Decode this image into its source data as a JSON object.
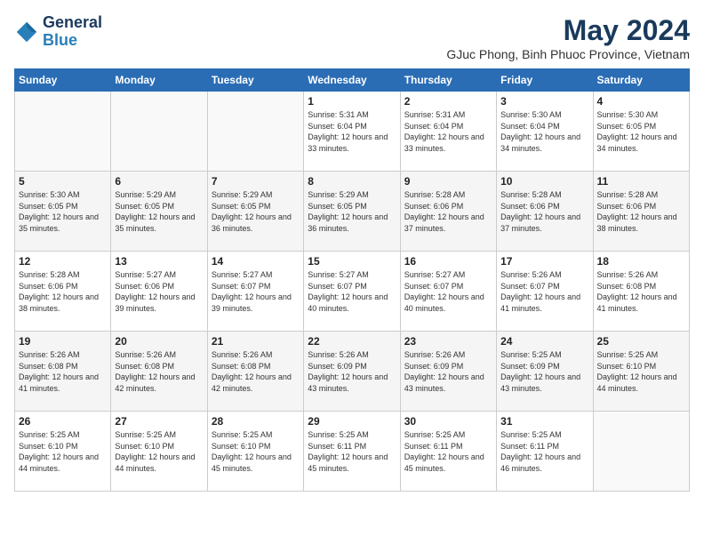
{
  "header": {
    "logo_line1": "General",
    "logo_line2": "Blue",
    "title": "May 2024",
    "subtitle": "GJuc Phong, Binh Phuoc Province, Vietnam"
  },
  "weekdays": [
    "Sunday",
    "Monday",
    "Tuesday",
    "Wednesday",
    "Thursday",
    "Friday",
    "Saturday"
  ],
  "weeks": [
    [
      {
        "day": "",
        "sunrise": "",
        "sunset": "",
        "daylight": ""
      },
      {
        "day": "",
        "sunrise": "",
        "sunset": "",
        "daylight": ""
      },
      {
        "day": "",
        "sunrise": "",
        "sunset": "",
        "daylight": ""
      },
      {
        "day": "1",
        "sunrise": "Sunrise: 5:31 AM",
        "sunset": "Sunset: 6:04 PM",
        "daylight": "Daylight: 12 hours and 33 minutes."
      },
      {
        "day": "2",
        "sunrise": "Sunrise: 5:31 AM",
        "sunset": "Sunset: 6:04 PM",
        "daylight": "Daylight: 12 hours and 33 minutes."
      },
      {
        "day": "3",
        "sunrise": "Sunrise: 5:30 AM",
        "sunset": "Sunset: 6:04 PM",
        "daylight": "Daylight: 12 hours and 34 minutes."
      },
      {
        "day": "4",
        "sunrise": "Sunrise: 5:30 AM",
        "sunset": "Sunset: 6:05 PM",
        "daylight": "Daylight: 12 hours and 34 minutes."
      }
    ],
    [
      {
        "day": "5",
        "sunrise": "Sunrise: 5:30 AM",
        "sunset": "Sunset: 6:05 PM",
        "daylight": "Daylight: 12 hours and 35 minutes."
      },
      {
        "day": "6",
        "sunrise": "Sunrise: 5:29 AM",
        "sunset": "Sunset: 6:05 PM",
        "daylight": "Daylight: 12 hours and 35 minutes."
      },
      {
        "day": "7",
        "sunrise": "Sunrise: 5:29 AM",
        "sunset": "Sunset: 6:05 PM",
        "daylight": "Daylight: 12 hours and 36 minutes."
      },
      {
        "day": "8",
        "sunrise": "Sunrise: 5:29 AM",
        "sunset": "Sunset: 6:05 PM",
        "daylight": "Daylight: 12 hours and 36 minutes."
      },
      {
        "day": "9",
        "sunrise": "Sunrise: 5:28 AM",
        "sunset": "Sunset: 6:06 PM",
        "daylight": "Daylight: 12 hours and 37 minutes."
      },
      {
        "day": "10",
        "sunrise": "Sunrise: 5:28 AM",
        "sunset": "Sunset: 6:06 PM",
        "daylight": "Daylight: 12 hours and 37 minutes."
      },
      {
        "day": "11",
        "sunrise": "Sunrise: 5:28 AM",
        "sunset": "Sunset: 6:06 PM",
        "daylight": "Daylight: 12 hours and 38 minutes."
      }
    ],
    [
      {
        "day": "12",
        "sunrise": "Sunrise: 5:28 AM",
        "sunset": "Sunset: 6:06 PM",
        "daylight": "Daylight: 12 hours and 38 minutes."
      },
      {
        "day": "13",
        "sunrise": "Sunrise: 5:27 AM",
        "sunset": "Sunset: 6:06 PM",
        "daylight": "Daylight: 12 hours and 39 minutes."
      },
      {
        "day": "14",
        "sunrise": "Sunrise: 5:27 AM",
        "sunset": "Sunset: 6:07 PM",
        "daylight": "Daylight: 12 hours and 39 minutes."
      },
      {
        "day": "15",
        "sunrise": "Sunrise: 5:27 AM",
        "sunset": "Sunset: 6:07 PM",
        "daylight": "Daylight: 12 hours and 40 minutes."
      },
      {
        "day": "16",
        "sunrise": "Sunrise: 5:27 AM",
        "sunset": "Sunset: 6:07 PM",
        "daylight": "Daylight: 12 hours and 40 minutes."
      },
      {
        "day": "17",
        "sunrise": "Sunrise: 5:26 AM",
        "sunset": "Sunset: 6:07 PM",
        "daylight": "Daylight: 12 hours and 41 minutes."
      },
      {
        "day": "18",
        "sunrise": "Sunrise: 5:26 AM",
        "sunset": "Sunset: 6:08 PM",
        "daylight": "Daylight: 12 hours and 41 minutes."
      }
    ],
    [
      {
        "day": "19",
        "sunrise": "Sunrise: 5:26 AM",
        "sunset": "Sunset: 6:08 PM",
        "daylight": "Daylight: 12 hours and 41 minutes."
      },
      {
        "day": "20",
        "sunrise": "Sunrise: 5:26 AM",
        "sunset": "Sunset: 6:08 PM",
        "daylight": "Daylight: 12 hours and 42 minutes."
      },
      {
        "day": "21",
        "sunrise": "Sunrise: 5:26 AM",
        "sunset": "Sunset: 6:08 PM",
        "daylight": "Daylight: 12 hours and 42 minutes."
      },
      {
        "day": "22",
        "sunrise": "Sunrise: 5:26 AM",
        "sunset": "Sunset: 6:09 PM",
        "daylight": "Daylight: 12 hours and 43 minutes."
      },
      {
        "day": "23",
        "sunrise": "Sunrise: 5:26 AM",
        "sunset": "Sunset: 6:09 PM",
        "daylight": "Daylight: 12 hours and 43 minutes."
      },
      {
        "day": "24",
        "sunrise": "Sunrise: 5:25 AM",
        "sunset": "Sunset: 6:09 PM",
        "daylight": "Daylight: 12 hours and 43 minutes."
      },
      {
        "day": "25",
        "sunrise": "Sunrise: 5:25 AM",
        "sunset": "Sunset: 6:10 PM",
        "daylight": "Daylight: 12 hours and 44 minutes."
      }
    ],
    [
      {
        "day": "26",
        "sunrise": "Sunrise: 5:25 AM",
        "sunset": "Sunset: 6:10 PM",
        "daylight": "Daylight: 12 hours and 44 minutes."
      },
      {
        "day": "27",
        "sunrise": "Sunrise: 5:25 AM",
        "sunset": "Sunset: 6:10 PM",
        "daylight": "Daylight: 12 hours and 44 minutes."
      },
      {
        "day": "28",
        "sunrise": "Sunrise: 5:25 AM",
        "sunset": "Sunset: 6:10 PM",
        "daylight": "Daylight: 12 hours and 45 minutes."
      },
      {
        "day": "29",
        "sunrise": "Sunrise: 5:25 AM",
        "sunset": "Sunset: 6:11 PM",
        "daylight": "Daylight: 12 hours and 45 minutes."
      },
      {
        "day": "30",
        "sunrise": "Sunrise: 5:25 AM",
        "sunset": "Sunset: 6:11 PM",
        "daylight": "Daylight: 12 hours and 45 minutes."
      },
      {
        "day": "31",
        "sunrise": "Sunrise: 5:25 AM",
        "sunset": "Sunset: 6:11 PM",
        "daylight": "Daylight: 12 hours and 46 minutes."
      },
      {
        "day": "",
        "sunrise": "",
        "sunset": "",
        "daylight": ""
      }
    ]
  ]
}
